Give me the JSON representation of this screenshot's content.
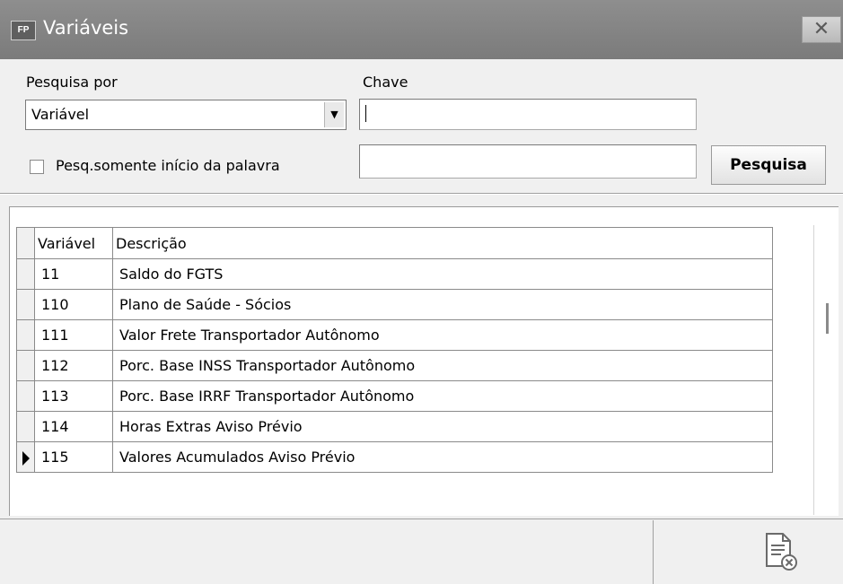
{
  "window": {
    "app_badge": "FP",
    "title": "Variáveis",
    "close_glyph": "✕"
  },
  "search": {
    "search_by_label": "Pesquisa por",
    "search_by_value": "Variável",
    "key_label": "Chave",
    "key_value": "",
    "key2_value": "",
    "starts_with_label": "Pesq.somente início da palavra",
    "starts_with_checked": false,
    "search_button": "Pesquisa"
  },
  "grid": {
    "columns": [
      "Variável",
      "Descrição"
    ],
    "rows": [
      {
        "code": "11",
        "description": "Saldo do FGTS",
        "current": false
      },
      {
        "code": "110",
        "description": "Plano de Saúde - Sócios",
        "current": false
      },
      {
        "code": "111",
        "description": "Valor Frete Transportador Autônomo",
        "current": false
      },
      {
        "code": "112",
        "description": "Porc. Base INSS Transportador Autônomo",
        "current": false
      },
      {
        "code": "113",
        "description": "Porc. Base IRRF Transportador Autônomo",
        "current": false
      },
      {
        "code": "114",
        "description": "Horas Extras Aviso Prévio",
        "current": false
      },
      {
        "code": "115",
        "description": "Valores Acumulados Aviso Prévio",
        "current": true
      }
    ]
  },
  "footer": {
    "icons": [
      "document-close-icon"
    ]
  },
  "colors": {
    "titlebar": "#808080",
    "window_bg": "#f0f0f0",
    "grid_border": "#8a8a8a"
  }
}
